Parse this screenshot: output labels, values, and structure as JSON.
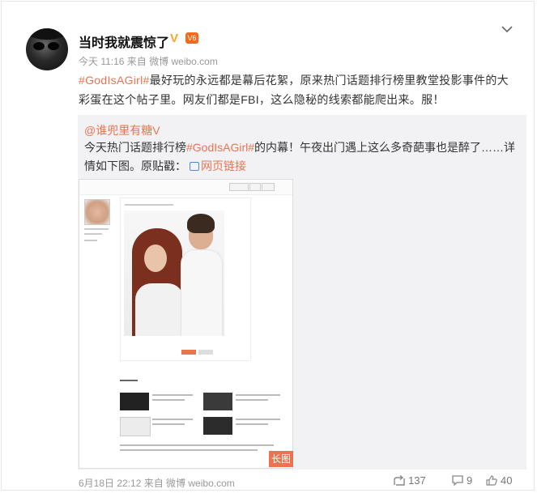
{
  "post": {
    "author": "当时我就震惊了",
    "verified_badge": "V",
    "level_badge": "V6",
    "meta": "今天 11:16 来自 微博 weibo.com",
    "text_tag": "#GodIsAGirl#",
    "text_body": "最好玩的永远都是幕后花絮，原来热门话题排行榜里教堂投影事件的大彩蛋在这个帖子里。网友们都是FBI，这么隐秘的线索都能爬出来。服！",
    "menu_icon": "chevron-down-icon"
  },
  "repost": {
    "author": "@谁兜里有糖V",
    "text_before": "今天热门话题排行榜",
    "text_tag": "#GodIsAGirl#",
    "text_after": "的内幕！午夜出门遇上这么多奇葩事也是醉了……详情如下图。原贴戳：",
    "link_label": "网页链接",
    "image_badge": "长图"
  },
  "footer": {
    "time": "6月18日 22:12 来自 微博 weibo.com",
    "repost_count": "137",
    "comment_count": "9",
    "like_count": "40"
  }
}
